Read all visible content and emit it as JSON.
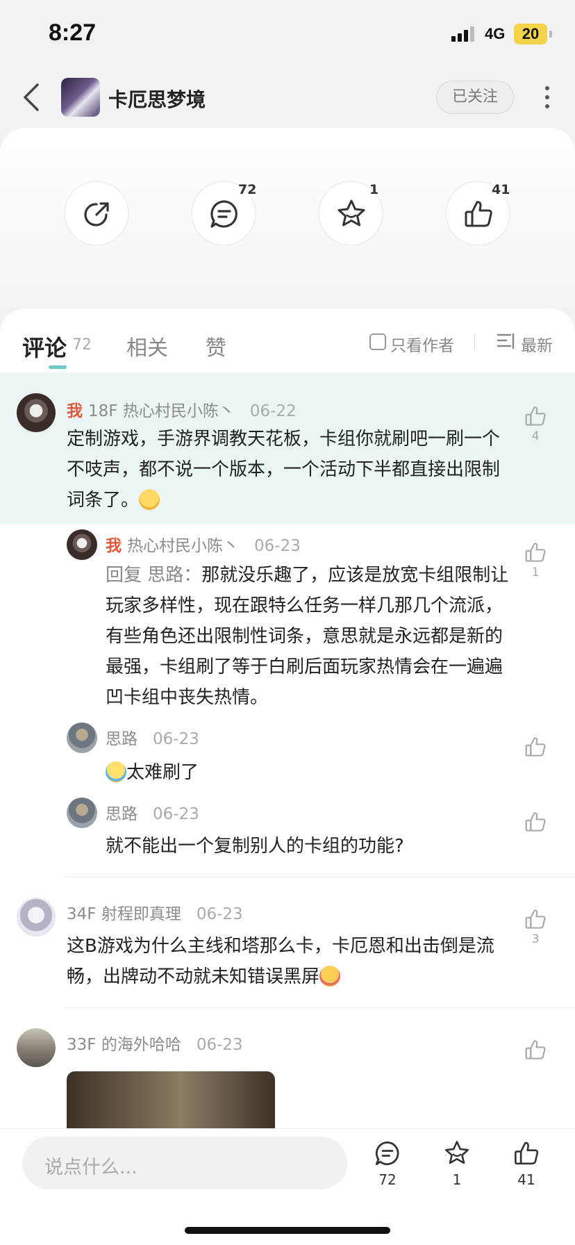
{
  "status": {
    "time": "8:27",
    "network": "4G",
    "battery": "20"
  },
  "header": {
    "title": "卡厄思梦境",
    "follow_label": "已关注"
  },
  "actions": [
    {
      "icon": "share-icon",
      "count": ""
    },
    {
      "icon": "comment-icon",
      "count": "72"
    },
    {
      "icon": "star-icon",
      "count": "1"
    },
    {
      "icon": "thumbs-up-icon",
      "count": "41"
    }
  ],
  "tabs": {
    "comments_label": "评论",
    "comments_count": "72",
    "related_label": "相关",
    "likes_label": "赞",
    "only_author": "只看作者",
    "sort_label": "最新"
  },
  "comments": [
    {
      "me": "我",
      "floor": "18F",
      "name": "热心村民小陈丶",
      "date": "06-22",
      "text": "定制游戏，手游界调教天花板，卡组你就刷吧一刷一个不吱声，都不说一个版本，一个活动下半都直接出限制词条了。",
      "likes": "4"
    },
    {
      "me": "我",
      "name": "热心村民小陈丶",
      "date": "06-23",
      "reply_prefix": "回复 思路：",
      "text": "那就没乐趣了，应该是放宽卡组限制让玩家多样性，现在跟特么任务一样几那几个流派，有些角色还出限制性词条，意思就是永远都是新的最强，卡组刷了等于白刷后面玩家热情会在一遍遍凹卡组中丧失热情。",
      "likes": "1"
    },
    {
      "name": "思路",
      "date": "06-23",
      "text": "太难刷了"
    },
    {
      "name": "思路",
      "date": "06-23",
      "text": "就不能出一个复制别人的卡组的功能?"
    },
    {
      "floor": "34F",
      "name": "射程即真理",
      "date": "06-23",
      "text": "这B游戏为什么主线和塔那么卡，卡厄恩和出击倒是流畅，出牌动不动就未知错误黑屏",
      "likes": "3"
    },
    {
      "floor": "33F",
      "name": "的海外哈哈",
      "date": "06-23"
    }
  ],
  "bottom": {
    "placeholder": "说点什么...",
    "comment_count": "72",
    "star_count": "1",
    "like_count": "41"
  }
}
